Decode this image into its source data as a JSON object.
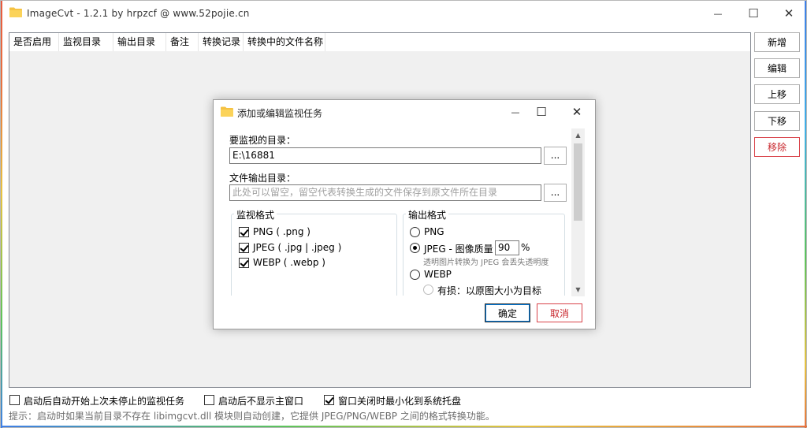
{
  "window": {
    "title": "ImageCvt - 1.2.1 by hrpzcf @ www.52pojie.cn",
    "controls": {
      "minimize": "—",
      "maximize": "☐",
      "close": "✕"
    }
  },
  "list": {
    "columns": [
      "是否启用",
      "监视目录",
      "输出目录",
      "备注",
      "转换记录",
      "转换中的文件名称"
    ]
  },
  "side_buttons": {
    "add": "新增",
    "edit": "编辑",
    "up": "上移",
    "down": "下移",
    "remove": "移除"
  },
  "options": {
    "autostart": {
      "label": "启动后自动开始上次未停止的监视任务",
      "checked": false
    },
    "hide_main": {
      "label": "启动后不显示主窗口",
      "checked": false
    },
    "minimize_tray": {
      "label": "窗口关闭时最小化到系统托盘",
      "checked": true
    }
  },
  "hint": "提示：启动时如果当前目录不存在 libimgcvt.dll 模块则自动创建，它提供 JPEG/PNG/WEBP 之间的格式转换功能。",
  "dialog": {
    "title": "添加或编辑监视任务",
    "controls": {
      "minimize": "—",
      "maximize": "☐",
      "close": "✕"
    },
    "watch_dir_label": "要监视的目录：",
    "watch_dir_value": "E:\\16881",
    "output_dir_label": "文件输出目录：",
    "output_dir_placeholder": "此处可以留空，留空代表转换生成的文件保存到原文件所在目录",
    "browse": "...",
    "watch_format": {
      "title": "监视格式",
      "items": [
        {
          "label": "PNG ( .png )",
          "checked": true
        },
        {
          "label": "JPEG ( .jpg | .jpeg )",
          "checked": true
        },
        {
          "label": "WEBP ( .webp )",
          "checked": true
        }
      ]
    },
    "output_format": {
      "title": "输出格式",
      "png": "PNG",
      "jpeg_label": "JPEG - 图像质量",
      "jpeg_quality": "90",
      "jpeg_unit": "%",
      "jpeg_note": "透明图片转换为 JPEG 会丢失透明度",
      "webp": "WEBP",
      "webp_lossy": "有损：以原图大小为目标",
      "selected": "JPEG"
    },
    "ok": "确定",
    "cancel": "取消"
  },
  "colors": {
    "folder": "#f5c242",
    "danger": "#d9434a",
    "accent": "#0078d7"
  }
}
